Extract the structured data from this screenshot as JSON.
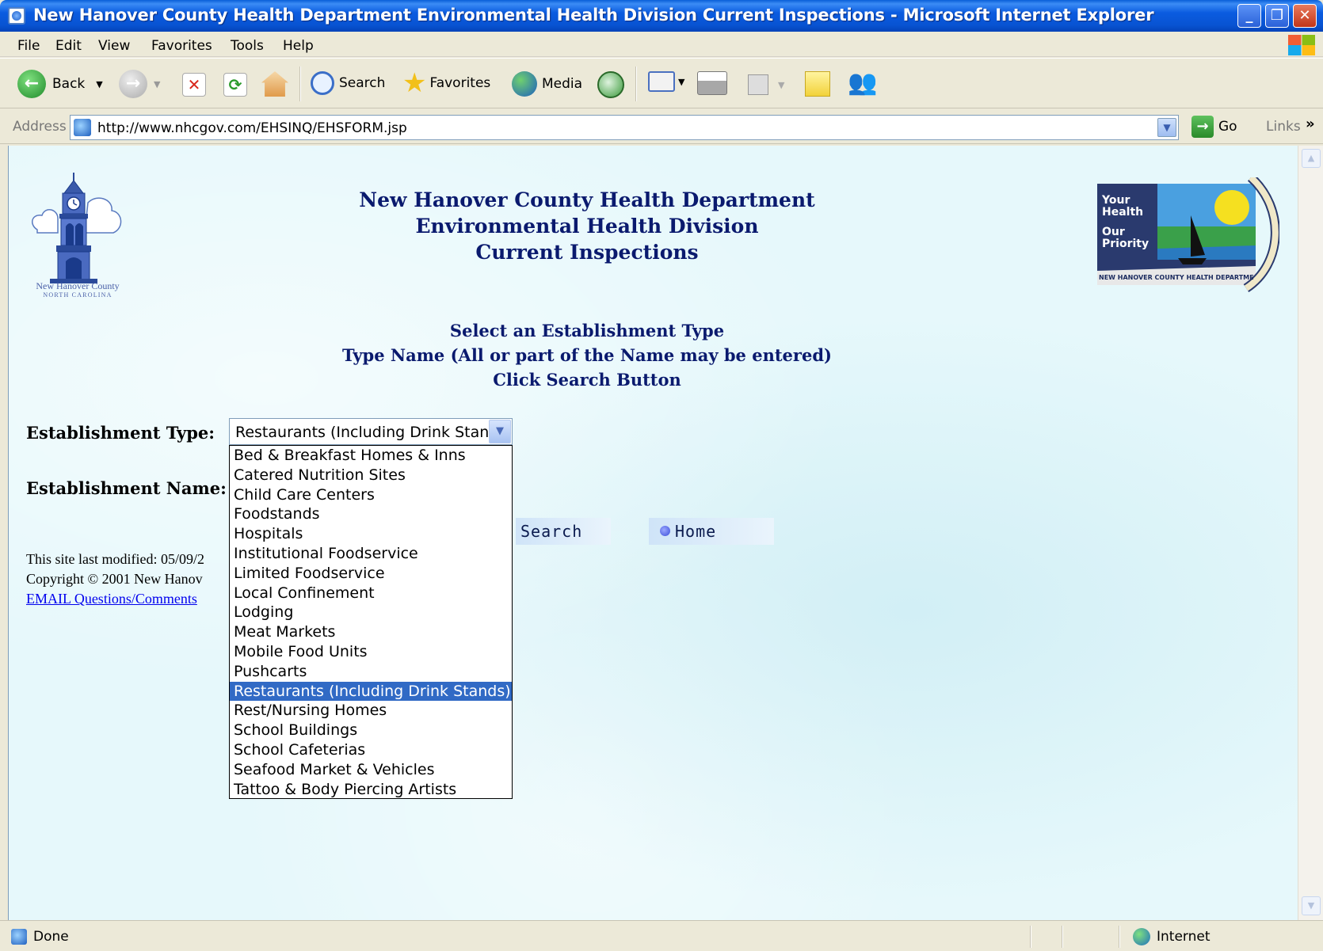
{
  "window": {
    "title": "New Hanover County Health Department Environmental Health Division Current Inspections - Microsoft Internet Explorer"
  },
  "menu": [
    "File",
    "Edit",
    "View",
    "Favorites",
    "Tools",
    "Help"
  ],
  "toolbar": {
    "back": "Back",
    "search": "Search",
    "favorites": "Favorites",
    "media": "Media"
  },
  "address": {
    "label": "Address",
    "url": "http://www.nhcgov.com/EHSINQ/EHSFORM.jsp",
    "go": "Go",
    "links": "Links"
  },
  "page": {
    "logo_caption": "New Hanover County",
    "logo_subcaption": "NORTH CAROLINA",
    "health_logo_text_1": "Your Health",
    "health_logo_text_2": "Our Priority",
    "health_logo_ring": "NEW HANOVER COUNTY HEALTH DEPARTMENT",
    "header": [
      "New Hanover County Health Department",
      "Environmental Health Division",
      "Current Inspections"
    ],
    "instructions": [
      "Select an Establishment Type",
      "Type Name (All or part of the Name may be entered)",
      "Click Search Button"
    ],
    "type_label": "Establishment Type:",
    "name_label": "Establishment Name:",
    "type_selected": "Restaurants (Including Drink Stands)",
    "type_options": [
      "Bed & Breakfast Homes & Inns",
      "Catered Nutrition Sites",
      "Child Care Centers",
      "Foodstands",
      "Hospitals",
      "Institutional Foodservice",
      "Limited Foodservice",
      "Local Confinement",
      "Lodging",
      "Meat Markets",
      "Mobile Food Units",
      "Pushcarts",
      "Restaurants (Including Drink Stands)",
      "Rest/Nursing Homes",
      "School Buildings",
      "School Cafeterias",
      "Seafood Market & Vehicles",
      "Tattoo & Body Piercing Artists"
    ],
    "search_button": "Search",
    "home_button": "Home",
    "footer_modified": "This site last modified: 05/09/2",
    "footer_copyright": "Copyright © 2001 New Hanov",
    "footer_email": "EMAIL Questions/Comments"
  },
  "status": {
    "text": "Done",
    "zone": "Internet"
  },
  "colors": {
    "title_blue": "#0853d2",
    "page_bg": "#e6f8fb",
    "heading_navy": "#0a1a6e",
    "selection_blue": "#316ac5",
    "link_blue": "#0000ee"
  }
}
